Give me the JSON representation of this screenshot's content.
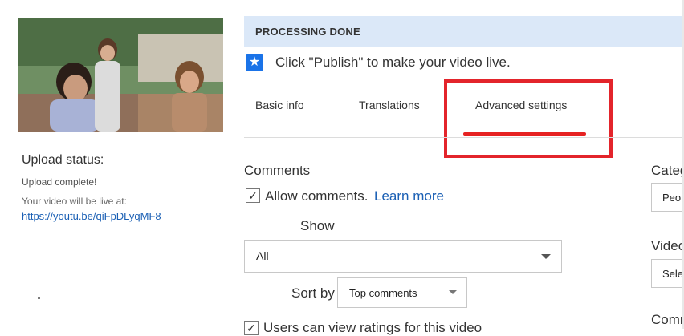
{
  "upload": {
    "status_title": "Upload status:",
    "complete_text": "Upload complete!",
    "live_at_text": "Your video will be live at:",
    "video_url": "https://youtu.be/qiFpDLyqMF8"
  },
  "banner": {
    "title": "PROCESSING DONE",
    "publish_message": "Click \"Publish\" to make your video live."
  },
  "tabs": [
    {
      "label": "Basic info",
      "active": false
    },
    {
      "label": "Translations",
      "active": false
    },
    {
      "label": "Advanced settings",
      "active": true
    }
  ],
  "comments": {
    "section_title": "Comments",
    "allow_label": "Allow comments.",
    "allow_checked": true,
    "learn_more": "Learn more",
    "show_label": "Show",
    "show_value": "All",
    "sort_label": "Sort by",
    "sort_value": "Top comments",
    "ratings_label": "Users can view ratings for this video",
    "ratings_checked": true
  },
  "right_column": {
    "category_label": "Categ",
    "category_value": "Peo",
    "video_label": "Video",
    "video_value": "Sele",
    "comm_label": "Comm"
  },
  "icons": {
    "star": "star-icon",
    "checkmark": "checkmark-icon",
    "caret": "chevron-down-icon"
  },
  "colors": {
    "banner_bg": "#dbe8f8",
    "link": "#1a5fb4",
    "highlight": "#e3242b",
    "star_badge": "#1a73e8"
  }
}
